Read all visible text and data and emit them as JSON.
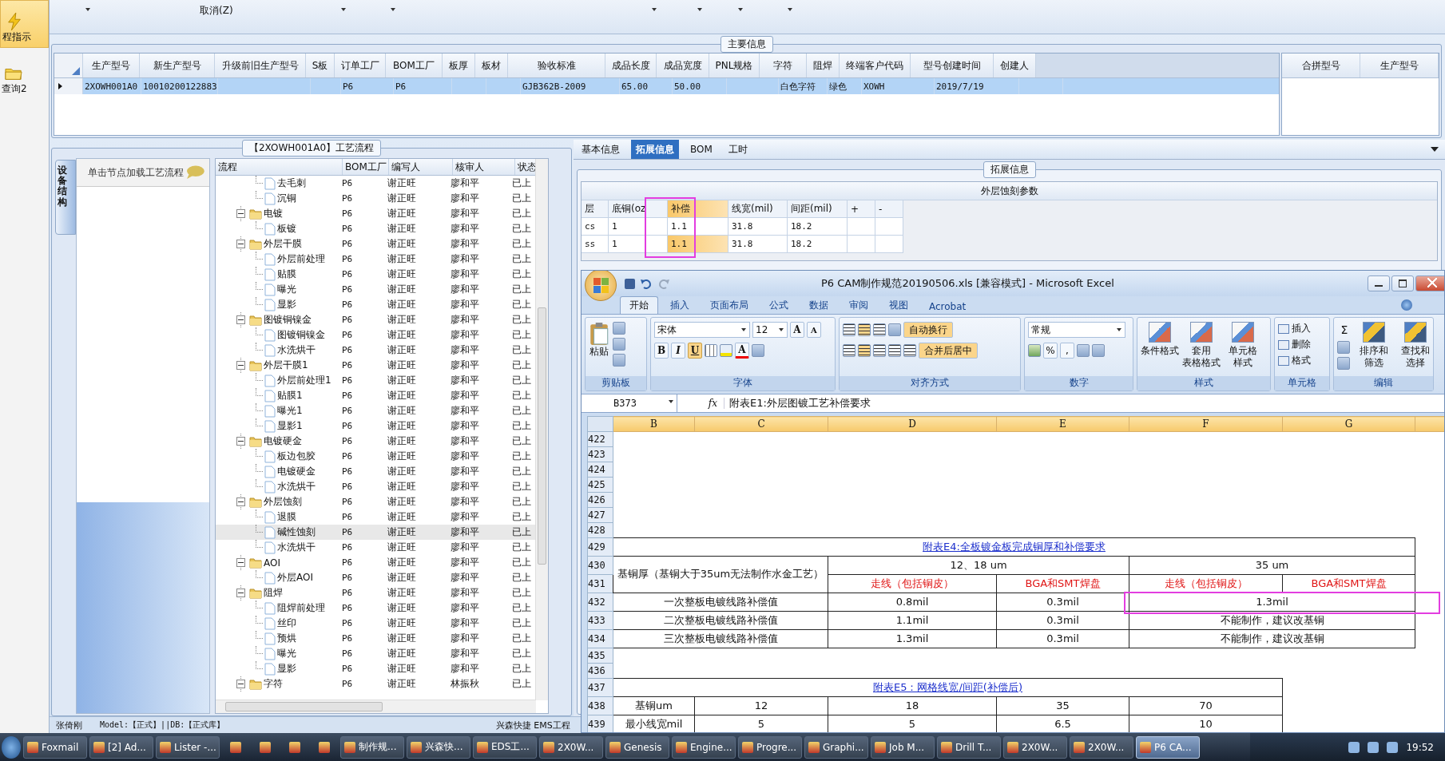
{
  "sidebar": {
    "items": [
      {
        "label": "程指示",
        "selected": true
      },
      {
        "label": "查询2",
        "selected": false
      }
    ]
  },
  "toolbar": {
    "label": "取消(Z)"
  },
  "main_info": {
    "title": "主要信息",
    "table": {
      "columns": [
        "生产型号",
        "新生产型号",
        "升级前旧生产型号",
        "S板",
        "订单工厂",
        "BOM工厂",
        "板厚",
        "板材",
        "验收标准",
        "成品长度",
        "成品宽度",
        "PNL规格",
        "字符",
        "阻焊",
        "终端客户代码",
        "型号创建时间",
        "创建人"
      ],
      "rows": [
        {
          "selected": true,
          "cells": [
            "2XOWH001A0",
            "10010200122883",
            null,
            null,
            "P6",
            "P6",
            null,
            null,
            "GJB362B-2009",
            "65.00",
            "50.00",
            null,
            "白色字符",
            "绿色",
            "XOWH",
            "2019/7/19",
            null
          ]
        }
      ]
    },
    "side_table": {
      "columns": [
        "合拼型号",
        "生产型号"
      ]
    }
  },
  "process": {
    "title": "【2XOWH001A0】工艺流程",
    "side_tab": "设备结构",
    "hint": "单击节点加载工艺流程",
    "columns": [
      "流程",
      "BOM工厂",
      "编写人",
      "核审人",
      "状态"
    ],
    "tree": [
      {
        "kind": "file",
        "label": "去毛刺",
        "bom": "P6",
        "author": "谢正旺",
        "reviewer": "廖和平",
        "status": "已上",
        "selected": false
      },
      {
        "kind": "file",
        "label": "沉铜",
        "bom": "P6",
        "author": "谢正旺",
        "reviewer": "廖和平",
        "status": "已上",
        "selected": false
      },
      {
        "kind": "folder",
        "label": "电镀",
        "bom": "P6",
        "author": "谢正旺",
        "reviewer": "廖和平",
        "status": "已上",
        "selected": false,
        "expanded": true,
        "children": [
          {
            "kind": "file",
            "label": "板镀",
            "bom": "P6",
            "author": "谢正旺",
            "reviewer": "廖和平",
            "status": "已上",
            "selected": false
          }
        ]
      },
      {
        "kind": "folder",
        "label": "外层干膜",
        "bom": "P6",
        "author": "谢正旺",
        "reviewer": "廖和平",
        "status": "已上",
        "selected": false,
        "expanded": true,
        "children": [
          {
            "kind": "file",
            "label": "外层前处理",
            "bom": "P6",
            "author": "谢正旺",
            "reviewer": "廖和平",
            "status": "已上",
            "selected": false
          },
          {
            "kind": "file",
            "label": "贴膜",
            "bom": "P6",
            "author": "谢正旺",
            "reviewer": "廖和平",
            "status": "已上",
            "selected": false
          },
          {
            "kind": "file",
            "label": "曝光",
            "bom": "P6",
            "author": "谢正旺",
            "reviewer": "廖和平",
            "status": "已上",
            "selected": false
          },
          {
            "kind": "file",
            "label": "显影",
            "bom": "P6",
            "author": "谢正旺",
            "reviewer": "廖和平",
            "status": "已上",
            "selected": false
          }
        ]
      },
      {
        "kind": "folder",
        "label": "图镀铜镍金",
        "bom": "P6",
        "author": "谢正旺",
        "reviewer": "廖和平",
        "status": "已上",
        "selected": false,
        "expanded": true,
        "children": [
          {
            "kind": "file",
            "label": "图镀铜镍金",
            "bom": "P6",
            "author": "谢正旺",
            "reviewer": "廖和平",
            "status": "已上",
            "selected": false
          },
          {
            "kind": "file",
            "label": "水洗烘干",
            "bom": "P6",
            "author": "谢正旺",
            "reviewer": "廖和平",
            "status": "已上",
            "selected": false
          }
        ]
      },
      {
        "kind": "folder",
        "label": "外层干膜1",
        "bom": "P6",
        "author": "谢正旺",
        "reviewer": "廖和平",
        "status": "已上",
        "selected": false,
        "expanded": true,
        "children": [
          {
            "kind": "file",
            "label": "外层前处理1",
            "bom": "P6",
            "author": "谢正旺",
            "reviewer": "廖和平",
            "status": "已上",
            "selected": false
          },
          {
            "kind": "file",
            "label": "贴膜1",
            "bom": "P6",
            "author": "谢正旺",
            "reviewer": "廖和平",
            "status": "已上",
            "selected": false
          },
          {
            "kind": "file",
            "label": "曝光1",
            "bom": "P6",
            "author": "谢正旺",
            "reviewer": "廖和平",
            "status": "已上",
            "selected": false
          },
          {
            "kind": "file",
            "label": "显影1",
            "bom": "P6",
            "author": "谢正旺",
            "reviewer": "廖和平",
            "status": "已上",
            "selected": false
          }
        ]
      },
      {
        "kind": "folder",
        "label": "电镀硬金",
        "bom": "P6",
        "author": "谢正旺",
        "reviewer": "廖和平",
        "status": "已上",
        "selected": false,
        "expanded": true,
        "children": [
          {
            "kind": "file",
            "label": "板边包胶",
            "bom": "P6",
            "author": "谢正旺",
            "reviewer": "廖和平",
            "status": "已上",
            "selected": false
          },
          {
            "kind": "file",
            "label": "电镀硬金",
            "bom": "P6",
            "author": "谢正旺",
            "reviewer": "廖和平",
            "status": "已上",
            "selected": false
          },
          {
            "kind": "file",
            "label": "水洗烘干",
            "bom": "P6",
            "author": "谢正旺",
            "reviewer": "廖和平",
            "status": "已上",
            "selected": false
          }
        ]
      },
      {
        "kind": "folder",
        "label": "外层蚀刻",
        "bom": "P6",
        "author": "谢正旺",
        "reviewer": "廖和平",
        "status": "已上",
        "selected": false,
        "expanded": true,
        "children": [
          {
            "kind": "file",
            "label": "退膜",
            "bom": "P6",
            "author": "谢正旺",
            "reviewer": "廖和平",
            "status": "已上",
            "selected": false
          },
          {
            "kind": "file",
            "label": "碱性蚀刻",
            "bom": "P6",
            "author": "谢正旺",
            "reviewer": "廖和平",
            "status": "已上",
            "selected": true
          },
          {
            "kind": "file",
            "label": "水洗烘干",
            "bom": "P6",
            "author": "谢正旺",
            "reviewer": "廖和平",
            "status": "已上",
            "selected": false
          }
        ]
      },
      {
        "kind": "folder",
        "label": "AOI",
        "bom": "P6",
        "author": "谢正旺",
        "reviewer": "廖和平",
        "status": "已上",
        "selected": false,
        "expanded": true,
        "children": [
          {
            "kind": "file",
            "label": "外层AOI",
            "bom": "P6",
            "author": "谢正旺",
            "reviewer": "廖和平",
            "status": "已上",
            "selected": false
          }
        ]
      },
      {
        "kind": "folder",
        "label": "阻焊",
        "bom": "P6",
        "author": "谢正旺",
        "reviewer": "廖和平",
        "status": "已上",
        "selected": false,
        "expanded": true,
        "children": [
          {
            "kind": "file",
            "label": "阻焊前处理",
            "bom": "P6",
            "author": "谢正旺",
            "reviewer": "廖和平",
            "status": "已上",
            "selected": false
          },
          {
            "kind": "file",
            "label": "丝印",
            "bom": "P6",
            "author": "谢正旺",
            "reviewer": "廖和平",
            "status": "已上",
            "selected": false
          },
          {
            "kind": "file",
            "label": "预烘",
            "bom": "P6",
            "author": "谢正旺",
            "reviewer": "廖和平",
            "status": "已上",
            "selected": false
          },
          {
            "kind": "file",
            "label": "曝光",
            "bom": "P6",
            "author": "谢正旺",
            "reviewer": "廖和平",
            "status": "已上",
            "selected": false
          },
          {
            "kind": "file",
            "label": "显影",
            "bom": "P6",
            "author": "谢正旺",
            "reviewer": "廖和平",
            "status": "已上",
            "selected": false
          }
        ]
      },
      {
        "kind": "folder",
        "label": "字符",
        "bom": "P6",
        "author": "谢正旺",
        "reviewer": "林振秋",
        "status": "已上",
        "selected": false,
        "expanded": true
      }
    ]
  },
  "detail": {
    "tabs": [
      {
        "label": "基本信息",
        "selected": false
      },
      {
        "label": "拓展信息",
        "selected": true
      },
      {
        "label": "BOM",
        "selected": false
      },
      {
        "label": "工时",
        "selected": false
      }
    ],
    "group": "拓展信息",
    "table": {
      "title": "外层蚀刻参数",
      "columns": [
        {
          "label": "层",
          "selected": false
        },
        {
          "label": "底铜(oz",
          "selected": false
        },
        {
          "label": "补偿",
          "selected": true
        },
        {
          "label": "线宽(mil)",
          "selected": false
        },
        {
          "label": "间距(mil)",
          "selected": false
        },
        {
          "label": "+",
          "selected": false
        },
        {
          "label": "-",
          "selected": false
        }
      ],
      "rows": [
        {
          "selected": false,
          "cells": [
            "cs",
            "1",
            "1.1",
            "31.8",
            "18.2"
          ]
        },
        {
          "selected": true,
          "cells": [
            "ss",
            "1",
            "1.1",
            "31.8",
            "18.2"
          ]
        }
      ]
    }
  },
  "excel": {
    "title": "P6 CAM制作规范20190506.xls  [兼容模式] - Microsoft Excel",
    "tabs": [
      {
        "label": "开始",
        "selected": true
      },
      {
        "label": "插入",
        "selected": false
      },
      {
        "label": "页面布局",
        "selected": false
      },
      {
        "label": "公式",
        "selected": false
      },
      {
        "label": "数据",
        "selected": false
      },
      {
        "label": "审阅",
        "selected": false
      },
      {
        "label": "视图",
        "selected": false
      },
      {
        "label": "Acrobat",
        "selected": false
      }
    ],
    "ribbon": {
      "clipboard": {
        "label": "剪贴板",
        "paste": "粘贴"
      },
      "font": {
        "label": "字体",
        "family": "宋体",
        "size": "12",
        "grow": "A",
        "shrink": "A",
        "bold": "B",
        "italic": "I",
        "underline": "U",
        "underline_on": true,
        "font_color_label": "A"
      },
      "alignment": {
        "label": "对齐方式",
        "wrap": "自动换行",
        "merge": "合并后居中"
      },
      "number": {
        "label": "数字",
        "format": "常规",
        "percent": "%",
        "comma": ","
      },
      "styles": {
        "label": "样式",
        "buttons": [
          {
            "lines": [
              "条件格式"
            ]
          },
          {
            "lines": [
              "套用",
              "表格格式"
            ]
          },
          {
            "lines": [
              "单元格",
              "样式"
            ]
          }
        ]
      },
      "cells": {
        "label": "单元格",
        "buttons": [
          "插入",
          "删除",
          "格式"
        ]
      },
      "editing": {
        "label": "编辑",
        "sum": "Σ",
        "buttons": [
          {
            "lines": [
              "排序和",
              "筛选"
            ]
          },
          {
            "lines": [
              "查找和",
              "选择"
            ]
          }
        ]
      }
    },
    "name_box": "B373",
    "fx": "fx",
    "formula": "附表E1:外层图镀工艺补偿要求",
    "sheet": {
      "columns": [
        "B",
        "C",
        "D",
        "E",
        "F",
        "G"
      ],
      "rows": [
        {
          "num": "422"
        },
        {
          "num": "423"
        },
        {
          "num": "424"
        },
        {
          "num": "425"
        },
        {
          "num": "426"
        },
        {
          "num": "427"
        },
        {
          "num": "428"
        },
        {
          "num": "429",
          "cells": [
            {
              "text": "附表E4:全板镀金板完成铜厚和补偿要求",
              "kind": "link"
            },
            {
              "kind": "span"
            },
            {
              "kind": "span"
            },
            {
              "kind": "span"
            },
            {
              "kind": "span"
            },
            {
              "kind": "span"
            }
          ]
        },
        {
          "num": "430",
          "cells": [
            {
              "text": "基铜厚（基铜大于35um无法制作水金工艺）"
            },
            {
              "kind": "span"
            },
            {
              "text": "12、18 um"
            },
            {
              "kind": "span"
            },
            {
              "text": "35 um"
            },
            {
              "kind": "span"
            }
          ]
        },
        {
          "num": "431",
          "cells": [
            {
              "kind": "under"
            },
            {
              "kind": "under"
            },
            {
              "text": "走线（包括铜皮）",
              "kind": "red"
            },
            {
              "text": "BGA和SMT焊盘",
              "kind": "red"
            },
            {
              "text": "走线（包括铜皮）",
              "kind": "red"
            },
            {
              "text": "BGA和SMT焊盘",
              "kind": "red"
            }
          ]
        },
        {
          "num": "432",
          "cells": [
            {
              "text": "一次整板电镀线路补偿值"
            },
            {
              "kind": "span"
            },
            {
              "text": "0.8mil"
            },
            {
              "text": "0.3mil"
            },
            {
              "text": "1.3mil"
            },
            {
              "kind": "span"
            }
          ]
        },
        {
          "num": "433",
          "cells": [
            {
              "text": "二次整板电镀线路补偿值"
            },
            {
              "kind": "span"
            },
            {
              "text": "1.1mil"
            },
            {
              "text": "0.3mil"
            },
            {
              "text": "不能制作，建议改基铜"
            },
            {
              "kind": "span"
            }
          ]
        },
        {
          "num": "434",
          "cells": [
            {
              "text": "三次整板电镀线路补偿值"
            },
            {
              "kind": "span"
            },
            {
              "text": "1.3mil"
            },
            {
              "text": "0.3mil"
            },
            {
              "text": "不能制作，建议改基铜"
            },
            {
              "kind": "span"
            }
          ]
        },
        {
          "num": "435"
        },
        {
          "num": "436"
        },
        {
          "num": "437",
          "cells": [
            {
              "text": "附表E5：网格线宽/间距(补偿后)",
              "kind": "link"
            },
            {
              "kind": "span"
            },
            {
              "kind": "span"
            },
            {
              "kind": "span"
            },
            {
              "kind": "span"
            }
          ]
        },
        {
          "num": "438",
          "cells": [
            {
              "text": "基铜um"
            },
            {
              "text": "12"
            },
            {
              "text": "18"
            },
            {
              "text": "35"
            },
            {
              "text": "70"
            }
          ]
        },
        {
          "num": "439",
          "cells": [
            {
              "text": "最小线宽mil"
            },
            {
              "text": "5"
            },
            {
              "text": "5"
            },
            {
              "text": "6.5"
            },
            {
              "text": "10"
            }
          ]
        }
      ]
    }
  },
  "status_bar": {
    "user": "张倚刚",
    "model": "Model:【正式】||DB:【正式库】",
    "company": "兴森快捷",
    "module": "EMS工程"
  },
  "taskbar": {
    "items": [
      {
        "kind": "app",
        "label": "Foxmail",
        "active": false
      },
      {
        "kind": "app",
        "label": "[2] Ad...",
        "active": false
      },
      {
        "kind": "app",
        "label": "Lister -...",
        "active": false
      },
      {
        "kind": "icon",
        "active": false
      },
      {
        "kind": "icon",
        "active": false
      },
      {
        "kind": "icon",
        "active": false
      },
      {
        "kind": "icon",
        "active": false
      },
      {
        "kind": "app",
        "label": "制作规...",
        "active": false
      },
      {
        "kind": "app",
        "label": "兴森快...",
        "active": false
      },
      {
        "kind": "app",
        "label": "EDS工...",
        "active": false
      },
      {
        "kind": "app",
        "label": "2X0W...",
        "active": false
      },
      {
        "kind": "app",
        "label": "Genesis",
        "active": false
      },
      {
        "kind": "app",
        "label": "Engine...",
        "active": false
      },
      {
        "kind": "app",
        "label": "Progre...",
        "active": false
      },
      {
        "kind": "app",
        "label": "Graphi...",
        "active": false
      },
      {
        "kind": "app",
        "label": "Job M...",
        "active": false
      },
      {
        "kind": "app",
        "label": "Drill T...",
        "active": false
      },
      {
        "kind": "app",
        "label": "2X0W...",
        "active": false
      },
      {
        "kind": "app",
        "label": "2X0W...",
        "active": false
      },
      {
        "kind": "app",
        "label": "P6 CA...",
        "active": true
      }
    ],
    "clock": "19:52"
  }
}
